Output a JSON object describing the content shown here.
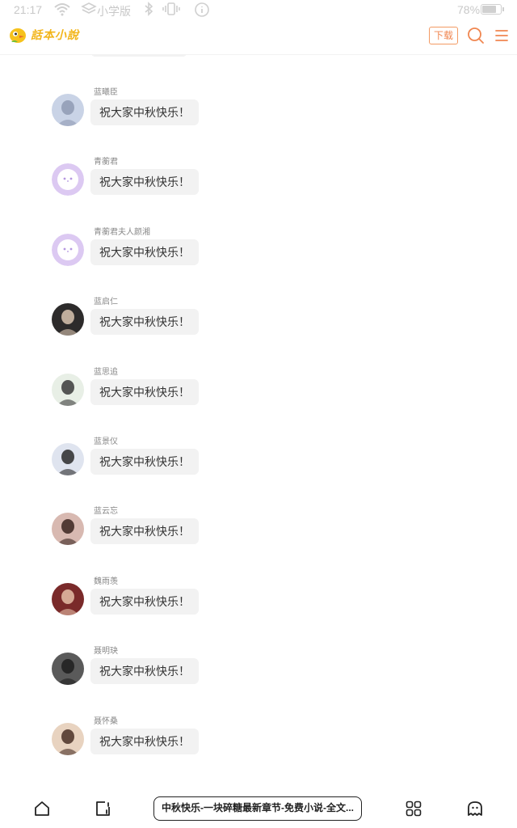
{
  "status_bar": {
    "time": "21:17",
    "app_mode": "小学版",
    "battery_percent": "78%",
    "battery_level": 0.78
  },
  "header": {
    "logo_text": "話本小說",
    "download_label": "下载",
    "accent_color": "#f08650"
  },
  "messages": [
    {
      "sender": "蓝曦臣",
      "text": "祝大家中秋快乐！",
      "avatar": "avatar-image"
    },
    {
      "sender": "青蘅君",
      "text": "祝大家中秋快乐！",
      "avatar": "default-avatar-icon"
    },
    {
      "sender": "青蘅君夫人颜湘",
      "text": "祝大家中秋快乐！",
      "avatar": "default-avatar-icon"
    },
    {
      "sender": "蓝启仁",
      "text": "祝大家中秋快乐！",
      "avatar": "avatar-image"
    },
    {
      "sender": "蓝思追",
      "text": "祝大家中秋快乐！",
      "avatar": "avatar-image"
    },
    {
      "sender": "蓝景仪",
      "text": "祝大家中秋快乐！",
      "avatar": "avatar-image"
    },
    {
      "sender": "蓝云忘",
      "text": "祝大家中秋快乐！",
      "avatar": "avatar-image"
    },
    {
      "sender": "魏雨羡",
      "text": "祝大家中秋快乐！",
      "avatar": "avatar-image"
    },
    {
      "sender": "聂明玦",
      "text": "祝大家中秋快乐！",
      "avatar": "avatar-image"
    },
    {
      "sender": "聂怀桑",
      "text": "祝大家中秋快乐！",
      "avatar": "avatar-image"
    }
  ],
  "bottom_bar": {
    "chapter_title": "中秋快乐-一块碎糖最新章节-免费小说-全文..."
  }
}
